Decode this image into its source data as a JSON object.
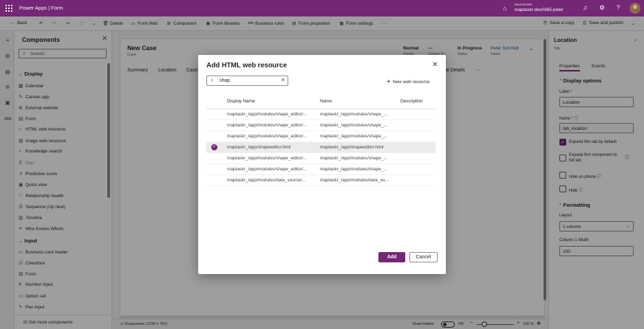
{
  "titlebar": {
    "app_title": "Power Apps | Form",
    "environment_label": "Environment",
    "environment_name": "maptaskr-dev0365-peter"
  },
  "commandbar": {
    "back": "Back",
    "delete": "Delete",
    "form_field": "Form field",
    "component": "Component",
    "form_libraries": "Form libraries",
    "business_rules": "Business rules",
    "form_properties": "Form properties",
    "form_settings": "Form settings",
    "more": "···",
    "save_copy": "Save a copy",
    "save_publish": "Save and publish"
  },
  "components": {
    "title": "Components",
    "search_placeholder": "Search",
    "display_section": "Display",
    "display_items": [
      {
        "label": "Calendar",
        "icon": "calendar-icon",
        "glyph": "▦"
      },
      {
        "label": "Canvas app",
        "icon": "canvas-app-icon",
        "glyph": "✎"
      },
      {
        "label": "External website",
        "icon": "globe-icon",
        "glyph": "⊕"
      },
      {
        "label": "Form",
        "icon": "form-icon",
        "glyph": "▤"
      },
      {
        "label": "HTML web resource",
        "icon": "code-icon",
        "glyph": "‹›"
      },
      {
        "label": "Image web resource",
        "icon": "image-icon",
        "glyph": "▨"
      },
      {
        "label": "Knowledge search",
        "icon": "knowledge-icon",
        "glyph": "⌕"
      },
      {
        "label": "Map",
        "icon": "map-icon",
        "glyph": "⚲"
      },
      {
        "label": "Predictive score",
        "icon": "score-icon",
        "glyph": "↗"
      },
      {
        "label": "Quick view",
        "icon": "quick-view-icon",
        "glyph": "▣"
      },
      {
        "label": "Relationship health",
        "icon": "health-icon",
        "glyph": "♡"
      },
      {
        "label": "Sequence (Up next)",
        "icon": "sequence-icon",
        "glyph": "☰"
      },
      {
        "label": "Timeline",
        "icon": "timeline-icon",
        "glyph": "▥"
      },
      {
        "label": "Who Knows Whom",
        "icon": "people-icon",
        "glyph": "⚭"
      }
    ],
    "input_section": "Input",
    "input_items": [
      {
        "label": "Business card reader",
        "icon": "card-icon",
        "glyph": "▭"
      },
      {
        "label": "Checkbox",
        "icon": "checkbox-icon",
        "glyph": "☑"
      },
      {
        "label": "Form",
        "icon": "form-icon",
        "glyph": "▤"
      },
      {
        "label": "Number Input",
        "icon": "number-icon",
        "glyph": "#"
      },
      {
        "label": "Option set",
        "icon": "option-set-icon",
        "glyph": "▭"
      },
      {
        "label": "Pen input",
        "icon": "pen-icon",
        "glyph": "✎"
      }
    ],
    "footer": "Get more components"
  },
  "form": {
    "title": "New Case",
    "entity": "Case",
    "priority_value": "Normal",
    "priority_label": "Priority",
    "origin_value": "---",
    "origin_label": "Contact Or...",
    "status_value": "In Progress",
    "status_label": "Status",
    "owner_value": "Peter Schmidt",
    "owner_label": "Owner",
    "tabs": [
      "Summary",
      "Location",
      "Case"
    ],
    "tab_right": "al Details",
    "tab_more": "···"
  },
  "statusbar": {
    "responsive": "Responsive (1234 x 797)",
    "show_hidden": "Show hidden",
    "toggle_state": "Off",
    "zoom": "100 %"
  },
  "properties": {
    "title": "Location",
    "subtitle": "Tab",
    "tab_properties": "Properties",
    "tab_events": "Events",
    "display_options": "Display options",
    "label_label": "Label",
    "label_value": "Location",
    "name_label": "Name",
    "name_value": "tab_location",
    "expand_by_default": "Expand this tab by default",
    "expand_first": "Expand first component to full tab",
    "hide_on_phone": "Hide on phone",
    "hide": "Hide",
    "formatting": "Formatting",
    "layout_label": "Layout",
    "layout_value": "1 column",
    "col_width_label": "Column 1 Width",
    "col_width_value": "100"
  },
  "dialog": {
    "title": "Add HTML web resource",
    "search_value": "shap",
    "new_resource": "New web resource",
    "col_display": "Display Name",
    "col_name": "Name",
    "col_desc": "Description",
    "rows": [
      {
        "display": "maptaskr_/app/modules/shape_editor/...",
        "name": "maptaskr_/app/modules/shape_...",
        "selected": false
      },
      {
        "display": "maptaskr_/app/modules/shape_editor/...",
        "name": "maptaskr_/app/modules/shape_...",
        "selected": false
      },
      {
        "display": "maptaskr_/app/modules/shape_editor/...",
        "name": "maptaskr_/app/modules/shape_...",
        "selected": false
      },
      {
        "display": "maptaskr_/app/shapeeditor.html",
        "name": "maptaskr_/app/shapeeditor.html",
        "selected": true
      },
      {
        "display": "maptaskr_/app/modules/shape_editor/...",
        "name": "maptaskr_/app/modules/shape_...",
        "selected": false
      },
      {
        "display": "maptaskr_/app/modules/shape_editor/...",
        "name": "maptaskr_/app/modules/shape_...",
        "selected": false
      },
      {
        "display": "maptaskr_/app/modules/data_source/...",
        "name": "maptaskr_/app/modules/data_so...",
        "selected": false
      }
    ],
    "add": "Add",
    "cancel": "Cancel"
  },
  "colors": {
    "brand": "#742774",
    "overlay": "rgba(0,0,0,0.38)",
    "owner_link": "#115ea3"
  }
}
